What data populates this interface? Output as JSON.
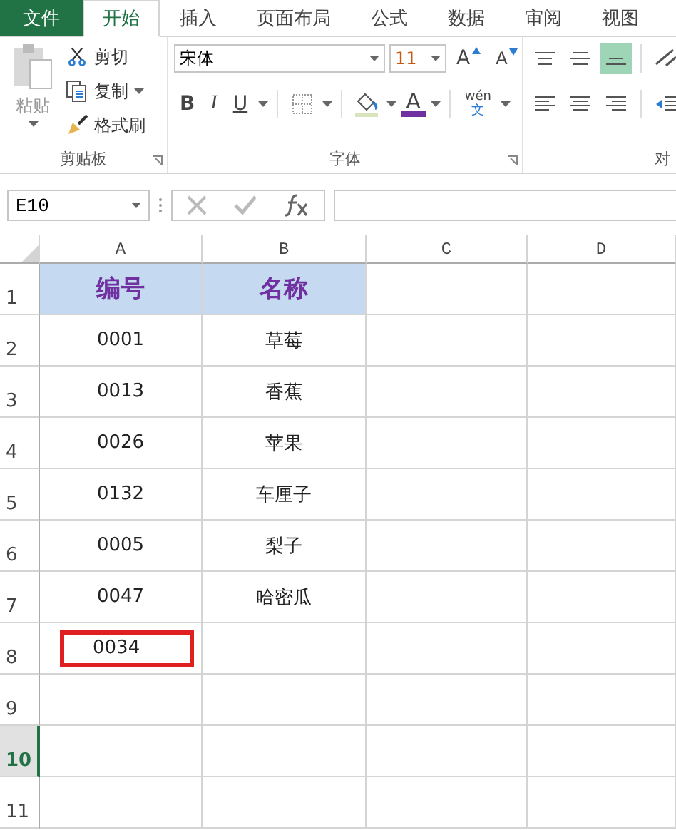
{
  "tabs": [
    {
      "label": "文件",
      "kind": "file",
      "selected": false
    },
    {
      "label": "开始",
      "kind": "tab",
      "selected": true
    },
    {
      "label": "插入",
      "kind": "tab",
      "selected": false
    },
    {
      "label": "页面布局",
      "kind": "tab",
      "selected": false
    },
    {
      "label": "公式",
      "kind": "tab",
      "selected": false
    },
    {
      "label": "数据",
      "kind": "tab",
      "selected": false
    },
    {
      "label": "审阅",
      "kind": "tab",
      "selected": false
    },
    {
      "label": "视图",
      "kind": "tab",
      "selected": false
    }
  ],
  "clipboard": {
    "paste": "粘贴",
    "cut": "剪切",
    "copy": "复制",
    "format_painter": "格式刷",
    "group_label": "剪贴板"
  },
  "font": {
    "name": "宋体",
    "size": "11",
    "grow": "A",
    "shrink": "A",
    "bold": "B",
    "italic": "I",
    "underline": "U",
    "font_color": "A",
    "phonetic_top": "wén",
    "phonetic_bottom": "文",
    "group_label": "字体"
  },
  "alignment": {
    "group_label": "对",
    "bottom_align_selected": true
  },
  "name_box": "E10",
  "columns": [
    "A",
    "B",
    "C",
    "D"
  ],
  "rows": [
    {
      "number": "1",
      "a": "编号",
      "b": "名称",
      "kind": "header",
      "selected": false
    },
    {
      "number": "2",
      "a": "0001",
      "b": "草莓",
      "kind": "data",
      "selected": false
    },
    {
      "number": "3",
      "a": "0013",
      "b": "香蕉",
      "kind": "data",
      "selected": false
    },
    {
      "number": "4",
      "a": "0026",
      "b": "苹果",
      "kind": "data",
      "selected": false
    },
    {
      "number": "5",
      "a": "0132",
      "b": "车厘子",
      "kind": "data",
      "selected": false
    },
    {
      "number": "6",
      "a": "0005",
      "b": "梨子",
      "kind": "data",
      "selected": false
    },
    {
      "number": "7",
      "a": "0047",
      "b": "哈密瓜",
      "kind": "data",
      "selected": false
    },
    {
      "number": "8",
      "a": "0034",
      "kind": "data",
      "highlighted": true,
      "selected": false
    },
    {
      "number": "9",
      "kind": "data",
      "selected": false
    },
    {
      "number": "10",
      "kind": "data",
      "selected": true
    },
    {
      "number": "11",
      "kind": "data",
      "selected": false
    }
  ]
}
